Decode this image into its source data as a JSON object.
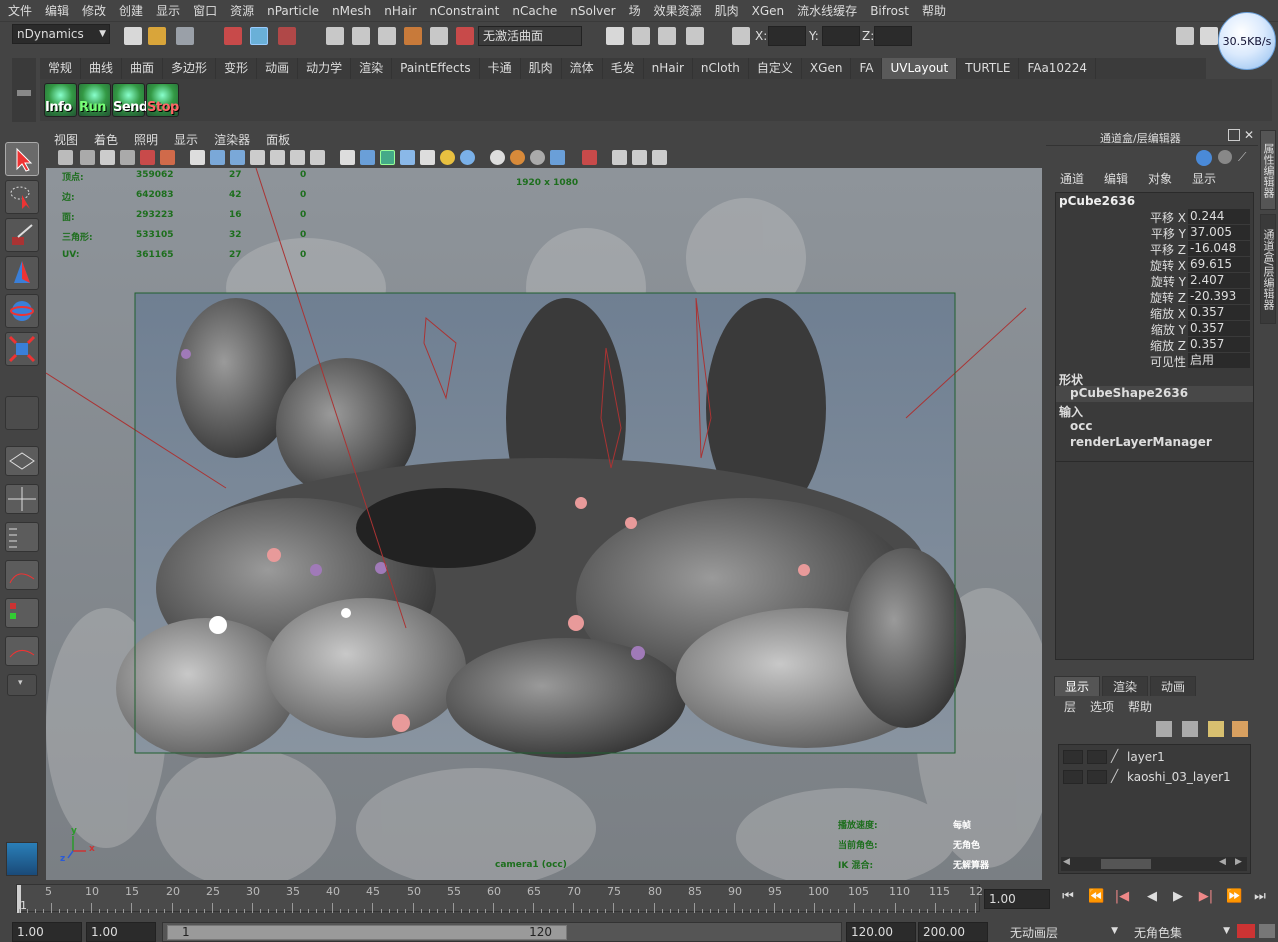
{
  "menubar": [
    "文件",
    "编辑",
    "修改",
    "创建",
    "显示",
    "窗口",
    "资源",
    "nParticle",
    "nMesh",
    "nHair",
    "nConstraint",
    "nCache",
    "nSolver",
    "场",
    "效果资源",
    "肌肉",
    "XGen",
    "流水线缓存",
    "Bifrost",
    "帮助"
  ],
  "statusline": {
    "menuset": "nDynamics",
    "live_surface": "无激活曲面",
    "x_label": "X:",
    "y_label": "Y:",
    "z_label": "Z:",
    "speed_badge": "30.5KB/s"
  },
  "shelf_tabs": [
    "常规",
    "曲线",
    "曲面",
    "多边形",
    "变形",
    "动画",
    "动力学",
    "渲染",
    "PaintEffects",
    "卡通",
    "肌肉",
    "流体",
    "毛发",
    "nHair",
    "nCloth",
    "自定义",
    "XGen",
    "FA",
    "UVLayout",
    "TURTLE",
    "FAa10224"
  ],
  "shelf_active": "UVLayout",
  "shelf_buttons": [
    "Info",
    "Run",
    "Send",
    "Stop"
  ],
  "viewport": {
    "menu": [
      "视图",
      "着色",
      "照明",
      "显示",
      "渲染器",
      "面板"
    ],
    "resolution": "1920 x 1080",
    "camera": "camera1 (occ)",
    "hud_stats": [
      {
        "label": "顶点:",
        "v1": "359062",
        "v2": "27",
        "v3": "0"
      },
      {
        "label": "边:",
        "v1": "642083",
        "v2": "42",
        "v3": "0"
      },
      {
        "label": "面:",
        "v1": "293223",
        "v2": "16",
        "v3": "0"
      },
      {
        "label": "三角形:",
        "v1": "533105",
        "v2": "32",
        "v3": "0"
      },
      {
        "label": "UV:",
        "v1": "361165",
        "v2": "27",
        "v3": "0"
      }
    ],
    "hud_bottom": [
      {
        "label": "播放速度:",
        "value": "每帧"
      },
      {
        "label": "当前角色:",
        "value": "无角色"
      },
      {
        "label": "IK 混合:",
        "value": "无解算器"
      }
    ],
    "axis_x": "x",
    "axis_y": "y",
    "axis_z": "z"
  },
  "channel_box": {
    "title": "通道盒/层编辑器",
    "menu": [
      "通道",
      "编辑",
      "对象",
      "显示"
    ],
    "object": "pCube2636",
    "attributes": [
      {
        "label": "平移 X",
        "value": "0.244"
      },
      {
        "label": "平移 Y",
        "value": "37.005"
      },
      {
        "label": "平移 Z",
        "value": "-16.048"
      },
      {
        "label": "旋转 X",
        "value": "69.615"
      },
      {
        "label": "旋转 Y",
        "value": "2.407"
      },
      {
        "label": "旋转 Z",
        "value": "-20.393"
      },
      {
        "label": "缩放 X",
        "value": "0.357"
      },
      {
        "label": "缩放 Y",
        "value": "0.357"
      },
      {
        "label": "缩放 Z",
        "value": "0.357"
      },
      {
        "label": "可见性",
        "value": "启用"
      }
    ],
    "shapes_header": "形状",
    "shape": "pCubeShape2636",
    "inputs_header": "输入",
    "inputs": [
      "occ",
      "renderLayerManager"
    ],
    "side_tabs": [
      "属性编辑器",
      "通道盒/层编辑器"
    ]
  },
  "layer_editor": {
    "tabs": [
      "显示",
      "渲染",
      "动画"
    ],
    "active_tab": "显示",
    "menu": [
      "层",
      "选项",
      "帮助"
    ],
    "layers": [
      "layer1",
      "kaoshi_03_layer1"
    ]
  },
  "time_slider": {
    "ticks": [
      "5",
      "10",
      "15",
      "20",
      "25",
      "30",
      "35",
      "40",
      "45",
      "50",
      "55",
      "60",
      "65",
      "70",
      "75",
      "80",
      "85",
      "90",
      "95",
      "100",
      "105",
      "110",
      "115",
      "12"
    ],
    "current_frame_marker": "1",
    "current_time": "1.00"
  },
  "range_slider": {
    "start_time": "1.00",
    "playback_start": "1.00",
    "range_start": "1",
    "range_end": "120",
    "playback_end": "120.00",
    "end_time": "200.00",
    "anim_layer": "无动画层",
    "character_set": "无角色集"
  }
}
